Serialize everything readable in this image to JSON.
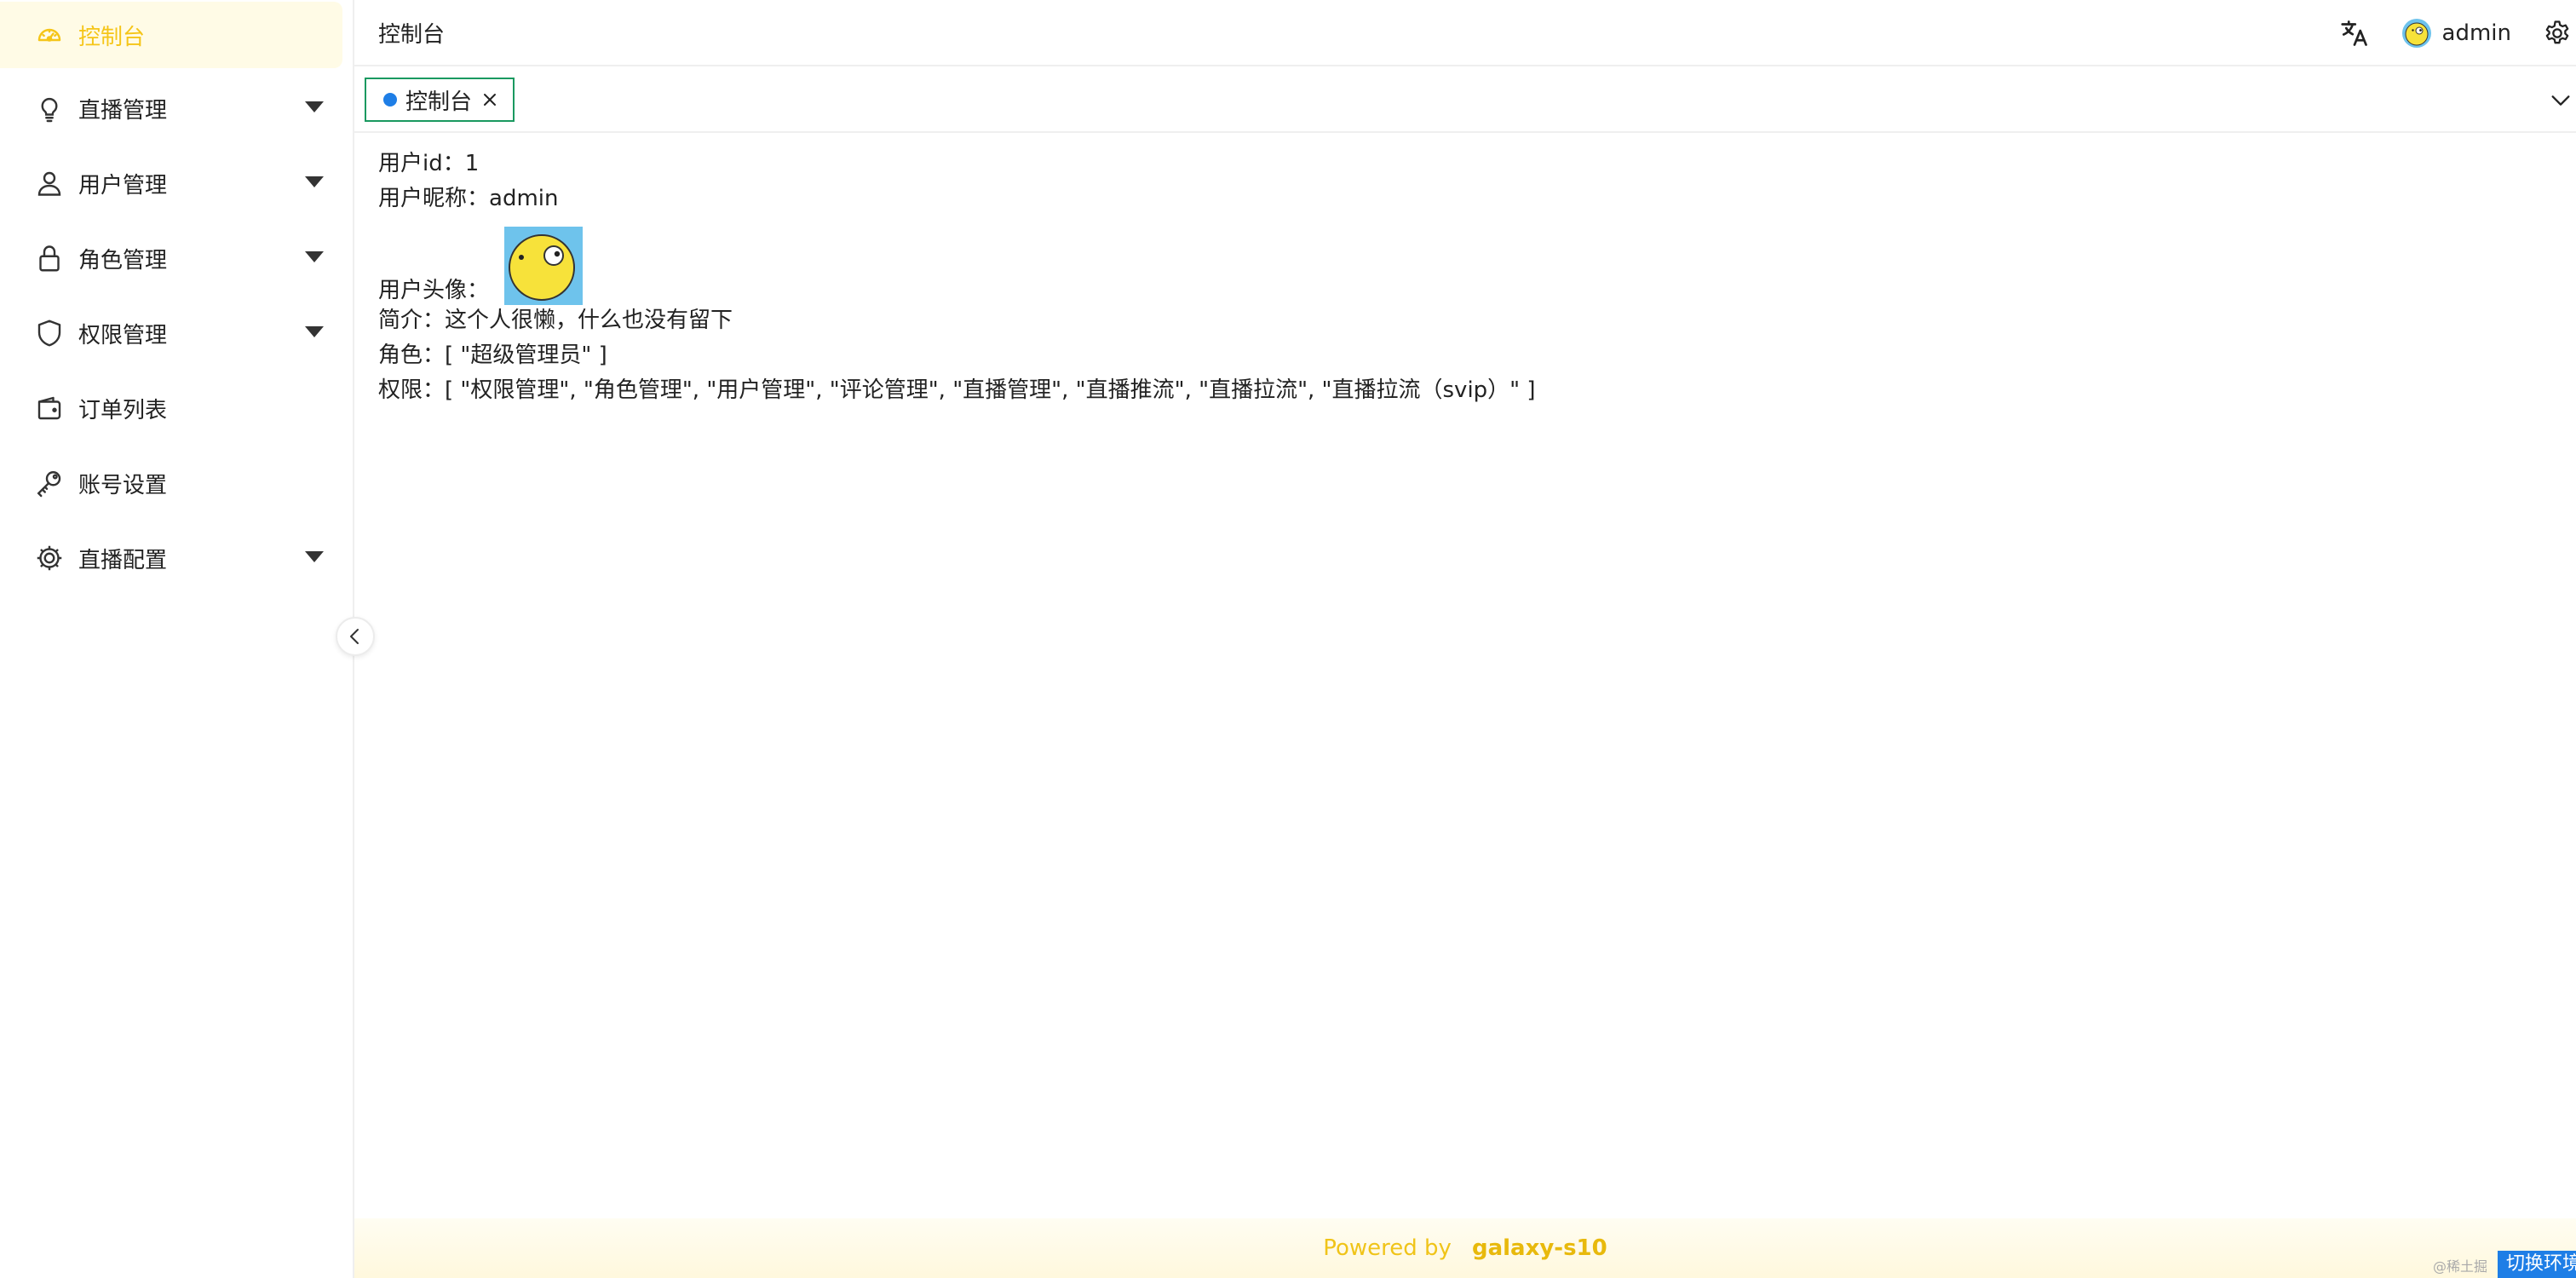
{
  "sidebar": {
    "items": [
      {
        "label": "控制台",
        "icon": "dashboard-icon",
        "active": true,
        "expandable": false
      },
      {
        "label": "直播管理",
        "icon": "bulb-icon",
        "active": false,
        "expandable": true
      },
      {
        "label": "用户管理",
        "icon": "user-icon",
        "active": false,
        "expandable": true
      },
      {
        "label": "角色管理",
        "icon": "lock-icon",
        "active": false,
        "expandable": true
      },
      {
        "label": "权限管理",
        "icon": "shield-icon",
        "active": false,
        "expandable": true
      },
      {
        "label": "订单列表",
        "icon": "wallet-icon",
        "active": false,
        "expandable": false
      },
      {
        "label": "账号设置",
        "icon": "key-icon",
        "active": false,
        "expandable": false
      },
      {
        "label": "直播配置",
        "icon": "gear-icon",
        "active": false,
        "expandable": true
      }
    ],
    "active_color": "#f5c518",
    "active_bg": "#fffbe6"
  },
  "header": {
    "title": "控制台",
    "username": "admin"
  },
  "tabs": [
    {
      "label": "控制台",
      "active": true
    }
  ],
  "profile": {
    "id_label": "用户id：",
    "id_value": "1",
    "nickname_label": "用户昵称：",
    "nickname_value": "admin",
    "avatar_label": "用户头像：",
    "bio_label": "简介：",
    "bio_value": "这个人很懒，什么也没有留下",
    "role_label": "角色：",
    "role_value": "[ \"超级管理员\" ]",
    "permission_label": "权限：",
    "permission_value": "[ \"权限管理\", \"角色管理\", \"用户管理\", \"评论管理\", \"直播管理\", \"直播推流\", \"直播拉流\", \"直播拉流（svip）\" ]"
  },
  "footer": {
    "powered_by": "Powered by",
    "brand": "galaxy-s10"
  },
  "watermark": "@稀土掘",
  "env_button": "切换环境",
  "colors": {
    "tab_border": "#1a9960",
    "tab_dot": "#1e7ee6",
    "footer_text": "#f0c419",
    "env_button_bg": "#1e7ee6"
  }
}
